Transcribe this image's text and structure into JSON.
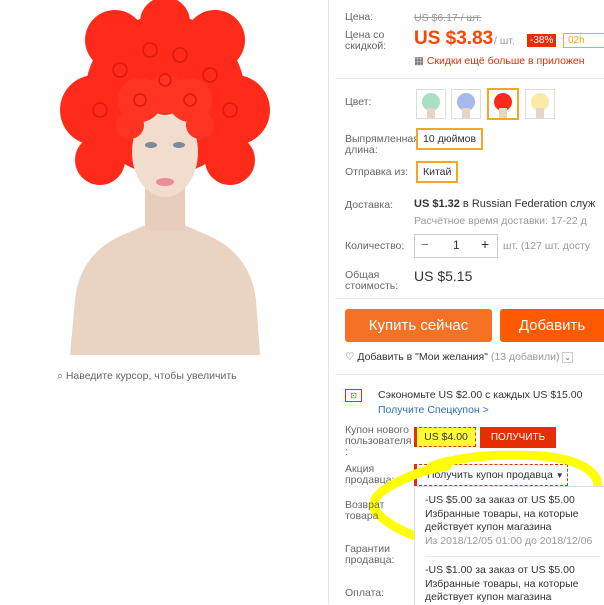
{
  "product_image": {
    "zoom_hint": "Наведите курсор, чтобы увеличить"
  },
  "price": {
    "label": "Цена:",
    "original": "US $6.17 / шт.",
    "discount_label": "Цена со скидкой:",
    "current": "US $3.83",
    "unit": "/ шт.",
    "badge": "-38%",
    "timer": "02h",
    "app_promo": "Скидки ещё больше в приложен"
  },
  "options": {
    "color_label": "Цвет:",
    "length_label": "Выпрямленная длина:",
    "length_value": "10 дюймов",
    "ship_from_label": "Отправка из:",
    "ship_from_value": "Китай"
  },
  "delivery": {
    "label": "Доставка:",
    "value_price": "US $1.32",
    "value_rest": " в Russian Federation служ",
    "eta": "Расчётное время доставки: 17-22 д"
  },
  "quantity": {
    "label": "Количество:",
    "minus": "−",
    "value": "1",
    "plus": "+",
    "available": "шт. (127 шт. досту"
  },
  "total": {
    "label": "Общая стоимость:",
    "value": "US $5.15"
  },
  "actions": {
    "buy_now": "Купить сейчас",
    "add_to_cart": "Добавить",
    "wishlist": "Добавить в \"Мои желания\"",
    "wishlist_count": "(13 добавили)"
  },
  "promo": {
    "save_text": "Сэкономьте US $2.00 с каждых US $15.00",
    "get_coupon": "Получите Спецкупон >",
    "new_user_label": "Купон нового пользователя :",
    "new_user_value": "US $4.00",
    "new_user_button": "ПОЛУЧИТЬ",
    "seller_label": "Акция продавца:",
    "seller_button": "Получить купон продавца",
    "return_label": "Возврат товара",
    "guarantee_label": "Гарантии продавца:",
    "payment_label": "Оплата:",
    "coupon1_line1": "-US $5.00 за заказ от US $5.00",
    "coupon1_line2": "Избранные товары, на которые",
    "coupon1_line3": "действует купон магазина",
    "coupon1_dates": "Из 2018/12/05 01:00 до 2018/12/06",
    "coupon2_line1": "-US $1.00 за заказ от US $5.00",
    "coupon2_line2": "Избранные товары, на которые",
    "coupon2_line3": "действует купон магазина"
  },
  "colors": {
    "accent": "#f5a623",
    "price": "#ff4400",
    "highlight": "#ffff00",
    "buy": "#f57224",
    "cart": "#ff5a00"
  }
}
